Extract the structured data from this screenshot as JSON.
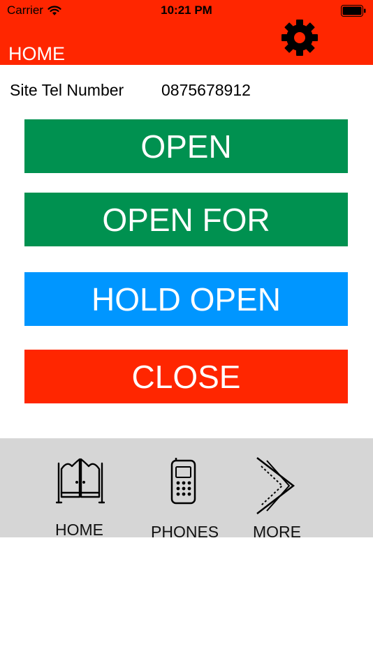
{
  "status_bar": {
    "carrier": "Carrier",
    "time": "10:21 PM"
  },
  "header": {
    "title": "HOME",
    "settings_icon": "gear-icon",
    "background": "#ff2600"
  },
  "site": {
    "label": "Site Tel Number",
    "value": "0875678912"
  },
  "actions": {
    "open": "OPEN",
    "open_for": "OPEN FOR",
    "hold_open": "HOLD OPEN",
    "close": "CLOSE"
  },
  "colors": {
    "green": "#009150",
    "blue": "#0096ff",
    "red": "#ff2600",
    "tabbar": "#d6d6d6"
  },
  "tabbar": {
    "items": [
      {
        "label": "HOME",
        "icon": "saloon-doors-icon"
      },
      {
        "label": "PHONES",
        "icon": "mobile-phone-icon"
      },
      {
        "label": "MORE",
        "icon": "chevron-right-icon"
      }
    ]
  }
}
